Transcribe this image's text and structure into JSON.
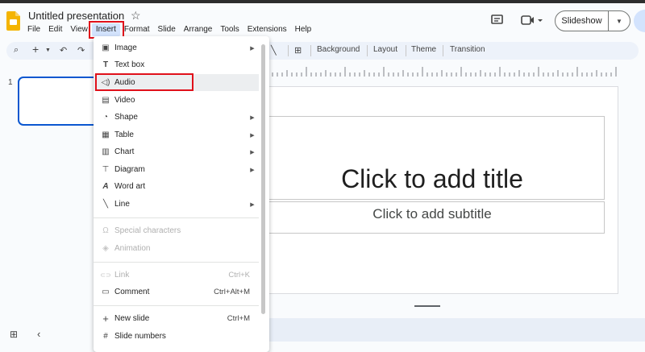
{
  "app": {
    "title": "Untitled presentation",
    "star_icon": "star-icon"
  },
  "menubar": {
    "items": [
      "File",
      "Edit",
      "View",
      "Insert",
      "Format",
      "Slide",
      "Arrange",
      "Tools",
      "Extensions",
      "Help"
    ],
    "active": "Insert"
  },
  "header": {
    "slideshow_label": "Slideshow"
  },
  "toolbar": {
    "background": "Background",
    "layout": "Layout",
    "theme": "Theme",
    "transition": "Transition"
  },
  "filmstrip": {
    "slide_number": "1"
  },
  "slide": {
    "title_placeholder": "Click to add title",
    "subtitle_placeholder": "Click to add subtitle"
  },
  "insert_menu": {
    "items": [
      {
        "label": "Image",
        "icon": "image-icon",
        "glyph": "▣",
        "submenu": true
      },
      {
        "label": "Text box",
        "icon": "text-box-icon",
        "glyph": "T",
        "submenu": false
      },
      {
        "label": "Audio",
        "icon": "audio-icon",
        "glyph": "🔈",
        "submenu": false
      },
      {
        "label": "Video",
        "icon": "video-icon",
        "glyph": "▤",
        "submenu": false
      },
      {
        "label": "Shape",
        "icon": "shape-icon",
        "glyph": "◔",
        "submenu": true
      },
      {
        "label": "Table",
        "icon": "table-icon",
        "glyph": "▦",
        "submenu": true
      },
      {
        "label": "Chart",
        "icon": "chart-icon",
        "glyph": "▥",
        "submenu": true
      },
      {
        "label": "Diagram",
        "icon": "diagram-icon",
        "glyph": "⊤",
        "submenu": true
      },
      {
        "label": "Word art",
        "icon": "word-art-icon",
        "glyph": "A",
        "submenu": false
      },
      {
        "label": "Line",
        "icon": "line-icon",
        "glyph": "╲",
        "submenu": true
      },
      {
        "label": "Special characters",
        "icon": "omega-icon",
        "glyph": "Ω",
        "disabled": true
      },
      {
        "label": "Animation",
        "icon": "animation-icon",
        "glyph": "◈",
        "disabled": true
      },
      {
        "label": "Link",
        "icon": "link-icon",
        "glyph": "⊂⊃",
        "shortcut": "Ctrl+K",
        "disabled": true
      },
      {
        "label": "Comment",
        "icon": "comment-icon",
        "glyph": "▭",
        "shortcut": "Ctrl+Alt+M"
      },
      {
        "label": "New slide",
        "icon": "plus-icon",
        "glyph": "+",
        "shortcut": "Ctrl+M"
      },
      {
        "label": "Slide numbers",
        "icon": "hash-icon",
        "glyph": "#"
      }
    ],
    "hovered": "Audio"
  },
  "colors": {
    "accent": "#0b57d0",
    "highlight": "#e0101a",
    "logo": "#f4b400"
  }
}
